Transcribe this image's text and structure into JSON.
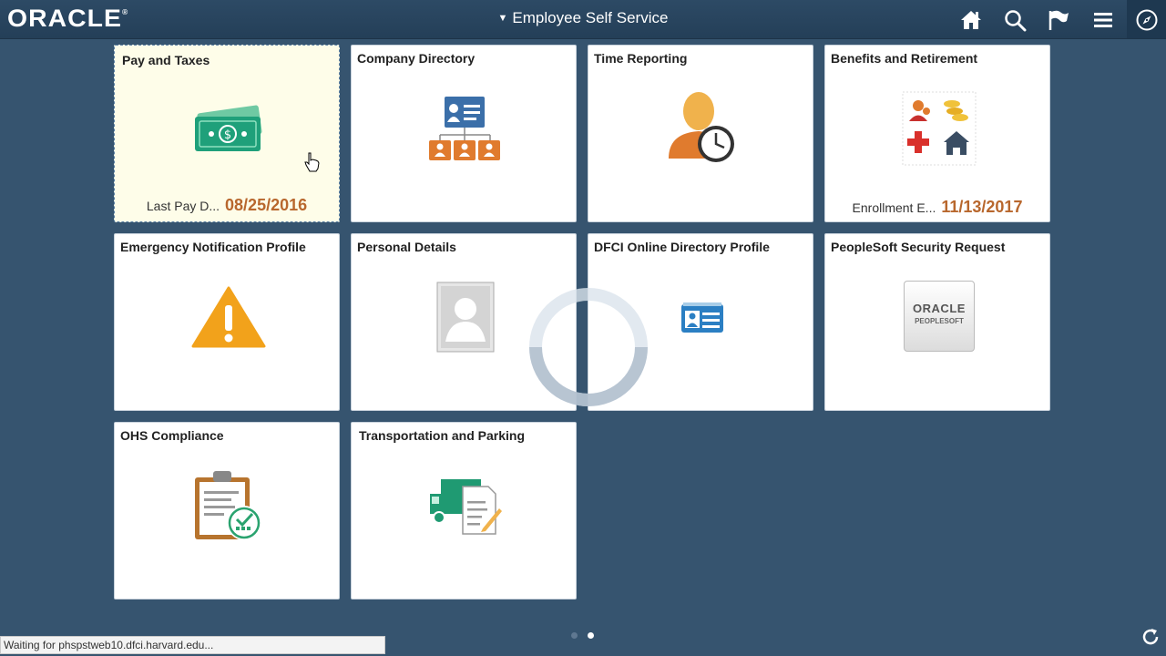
{
  "header": {
    "logo_text": "ORACLE",
    "title": "Employee Self Service",
    "icons": [
      "home-icon",
      "search-icon",
      "flag-icon",
      "menu-icon",
      "navbar-compass-icon"
    ]
  },
  "tiles": [
    {
      "title": "Pay and Taxes",
      "footer_label": "Last Pay D...",
      "footer_value": "08/25/2016",
      "icon": "money-icon",
      "state": "hover"
    },
    {
      "title": "Company Directory",
      "icon": "org-chart-icon"
    },
    {
      "title": "Time Reporting",
      "icon": "person-clock-icon"
    },
    {
      "title": "Benefits and Retirement",
      "footer_label": "Enrollment E...",
      "footer_value": "11/13/2017",
      "icon": "benefits-icon"
    },
    {
      "title": "Emergency Notification Profile",
      "icon": "warning-icon"
    },
    {
      "title": "Personal Details",
      "icon": "person-photo-icon"
    },
    {
      "title": "DFCI Online Directory Profile",
      "icon": "id-card-icon"
    },
    {
      "title": "PeopleSoft Security Request",
      "icon": "oracle-peoplesoft-logo",
      "logo_line1": "ORACLE",
      "logo_line2": "PEOPLESOFT"
    },
    {
      "title": "OHS Compliance",
      "icon": "clipboard-check-icon"
    },
    {
      "title": "Transportation and Parking",
      "icon": "truck-document-icon"
    }
  ],
  "status_bar": "Waiting for phspstweb10.dfci.harvard.edu...",
  "pagination": {
    "pages": 2,
    "current": 2
  },
  "colors": {
    "background": "#36546f",
    "header": "#2d4a65",
    "accent_date": "#b8672d",
    "tile_hover": "#fefde9"
  }
}
